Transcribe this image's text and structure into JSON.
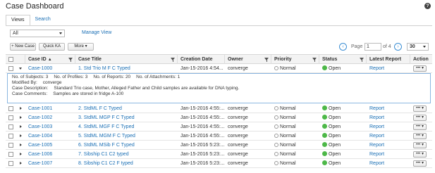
{
  "page": {
    "title": "Case Dashboard",
    "help_icon": "question-icon"
  },
  "tabs": [
    {
      "label": "Views",
      "active": true
    },
    {
      "label": "Search",
      "active": false
    }
  ],
  "view_filter": {
    "selected": "All"
  },
  "manage_view_label": "Manage View",
  "toolbar": {
    "new_case_label": "+ New Case",
    "quick_ka_label": "Quick KA",
    "more_label": "More ▾",
    "page_label": "Page",
    "page_value": "1",
    "page_of": "of 4",
    "per_page": "30"
  },
  "columns": [
    {
      "label": "Case ID",
      "sorted": "▲"
    },
    {
      "label": "Case Title"
    },
    {
      "label": "Creation Date"
    },
    {
      "label": "Owner"
    },
    {
      "label": "Priority"
    },
    {
      "label": "Status"
    },
    {
      "label": "Latest Report"
    },
    {
      "label": "Action"
    }
  ],
  "rows": [
    {
      "id": "Case-1000",
      "title": "1. Std Trio M F C Typed",
      "date": "Jan-15-2016 4:54...",
      "owner": "converge",
      "priority": "Normal",
      "status": "Open",
      "report": "Report",
      "expanded": true
    },
    {
      "id": "Case-1001",
      "title": "2. StdML F C Typed",
      "date": "Jan-15-2016 4:55:...",
      "owner": "converge",
      "priority": "Normal",
      "status": "Open",
      "report": "Report"
    },
    {
      "id": "Case-1002",
      "title": "3. StdML MGP F C Typed",
      "date": "Jan-15-2016 4:55:...",
      "owner": "converge",
      "priority": "Normal",
      "status": "Open",
      "report": "Report"
    },
    {
      "id": "Case-1003",
      "title": "4. StdML MGF F C Typed",
      "date": "Jan-15-2016 4:55:...",
      "owner": "converge",
      "priority": "Normal",
      "status": "Open",
      "report": "Report"
    },
    {
      "id": "Case-1004",
      "title": "5. StdML MGM F C Typed",
      "date": "Jan-15-2016 4:55:...",
      "owner": "converge",
      "priority": "Normal",
      "status": "Open",
      "report": "Report"
    },
    {
      "id": "Case-1005",
      "title": "6. StdML MSib F C Typed",
      "date": "Jan-15-2016 5:23:...",
      "owner": "converge",
      "priority": "Normal",
      "status": "Open",
      "report": "Report"
    },
    {
      "id": "Case-1006",
      "title": "7. Sibship C1 C2 typed",
      "date": "Jan-15-2016 5:23:...",
      "owner": "converge",
      "priority": "Normal",
      "status": "Open",
      "report": "Report"
    },
    {
      "id": "Case-1007",
      "title": "8. Sibship C1 C2 F typed",
      "date": "Jan-15-2016 5:23:...",
      "owner": "converge",
      "priority": "Normal",
      "status": "Open",
      "report": "Report"
    }
  ],
  "detail": {
    "subjects_label": "No. of Subjects:",
    "subjects": "3",
    "profiles_label": "No. of Profiles:",
    "profiles": "3",
    "reports_label": "No. of Reports:",
    "reports": "20",
    "attachments_label": "No. of Attachments:",
    "attachments": "1",
    "modified_label": "Modified By:",
    "modified": "converge",
    "description_label": "Case Description:",
    "description": "Standard Trio case, Mother, Alleged Father and Child samples are available for DNA typing.",
    "comments_label": "Case Comments:",
    "comments": "Samples are stored in fridge A-100"
  },
  "action_label": "•••  ▾",
  "colors": {
    "link": "#1a6fb5",
    "status_open": "#4db848",
    "header_bg": "#f3f3f3"
  }
}
